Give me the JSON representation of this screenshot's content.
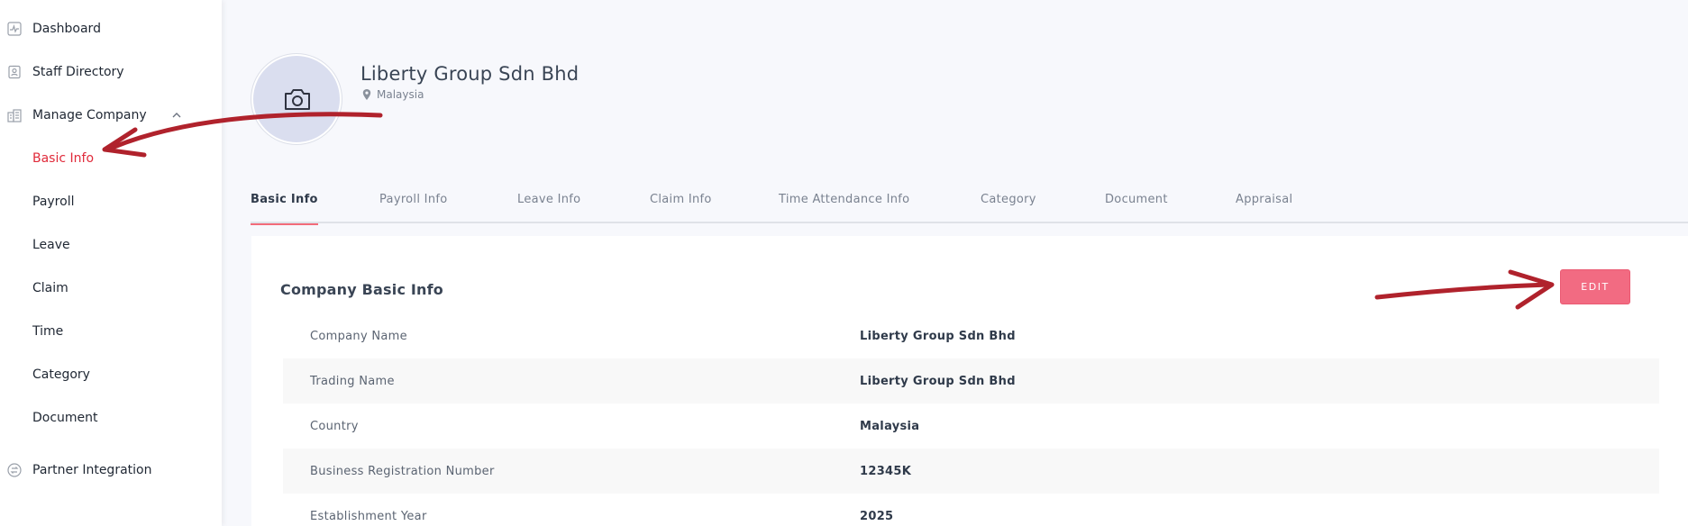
{
  "sidebar": {
    "items": [
      {
        "label": "Dashboard",
        "icon": "activity-icon"
      },
      {
        "label": "Staff Directory",
        "icon": "id-card-icon"
      },
      {
        "label": "Manage Company",
        "icon": "building-icon"
      },
      {
        "label": "Basic Info"
      },
      {
        "label": "Payroll"
      },
      {
        "label": "Leave"
      },
      {
        "label": "Claim"
      },
      {
        "label": "Time"
      },
      {
        "label": "Category"
      },
      {
        "label": "Document"
      },
      {
        "label": "Partner Integration",
        "icon": "exchange-icon"
      }
    ],
    "active_color": "#e02a3a"
  },
  "company": {
    "name": "Liberty Group Sdn Bhd",
    "location": "Malaysia"
  },
  "tabs": [
    {
      "label": "Basic Info",
      "active": true
    },
    {
      "label": "Payroll Info"
    },
    {
      "label": "Leave Info"
    },
    {
      "label": "Claim Info"
    },
    {
      "label": "Time Attendance Info"
    },
    {
      "label": "Category"
    },
    {
      "label": "Document"
    },
    {
      "label": "Appraisal"
    }
  ],
  "card": {
    "title": "Company Basic Info",
    "edit_label": "EDIT",
    "rows": [
      {
        "label": "Company Name",
        "value": "Liberty Group Sdn Bhd"
      },
      {
        "label": "Trading Name",
        "value": "Liberty Group Sdn Bhd"
      },
      {
        "label": "Country",
        "value": "Malaysia"
      },
      {
        "label": "Business Registration Number",
        "value": "12345K"
      },
      {
        "label": "Establishment Year",
        "value": "2025"
      }
    ]
  },
  "colors": {
    "accent": "#f26b82",
    "annotation_arrow": "#b0222c"
  }
}
